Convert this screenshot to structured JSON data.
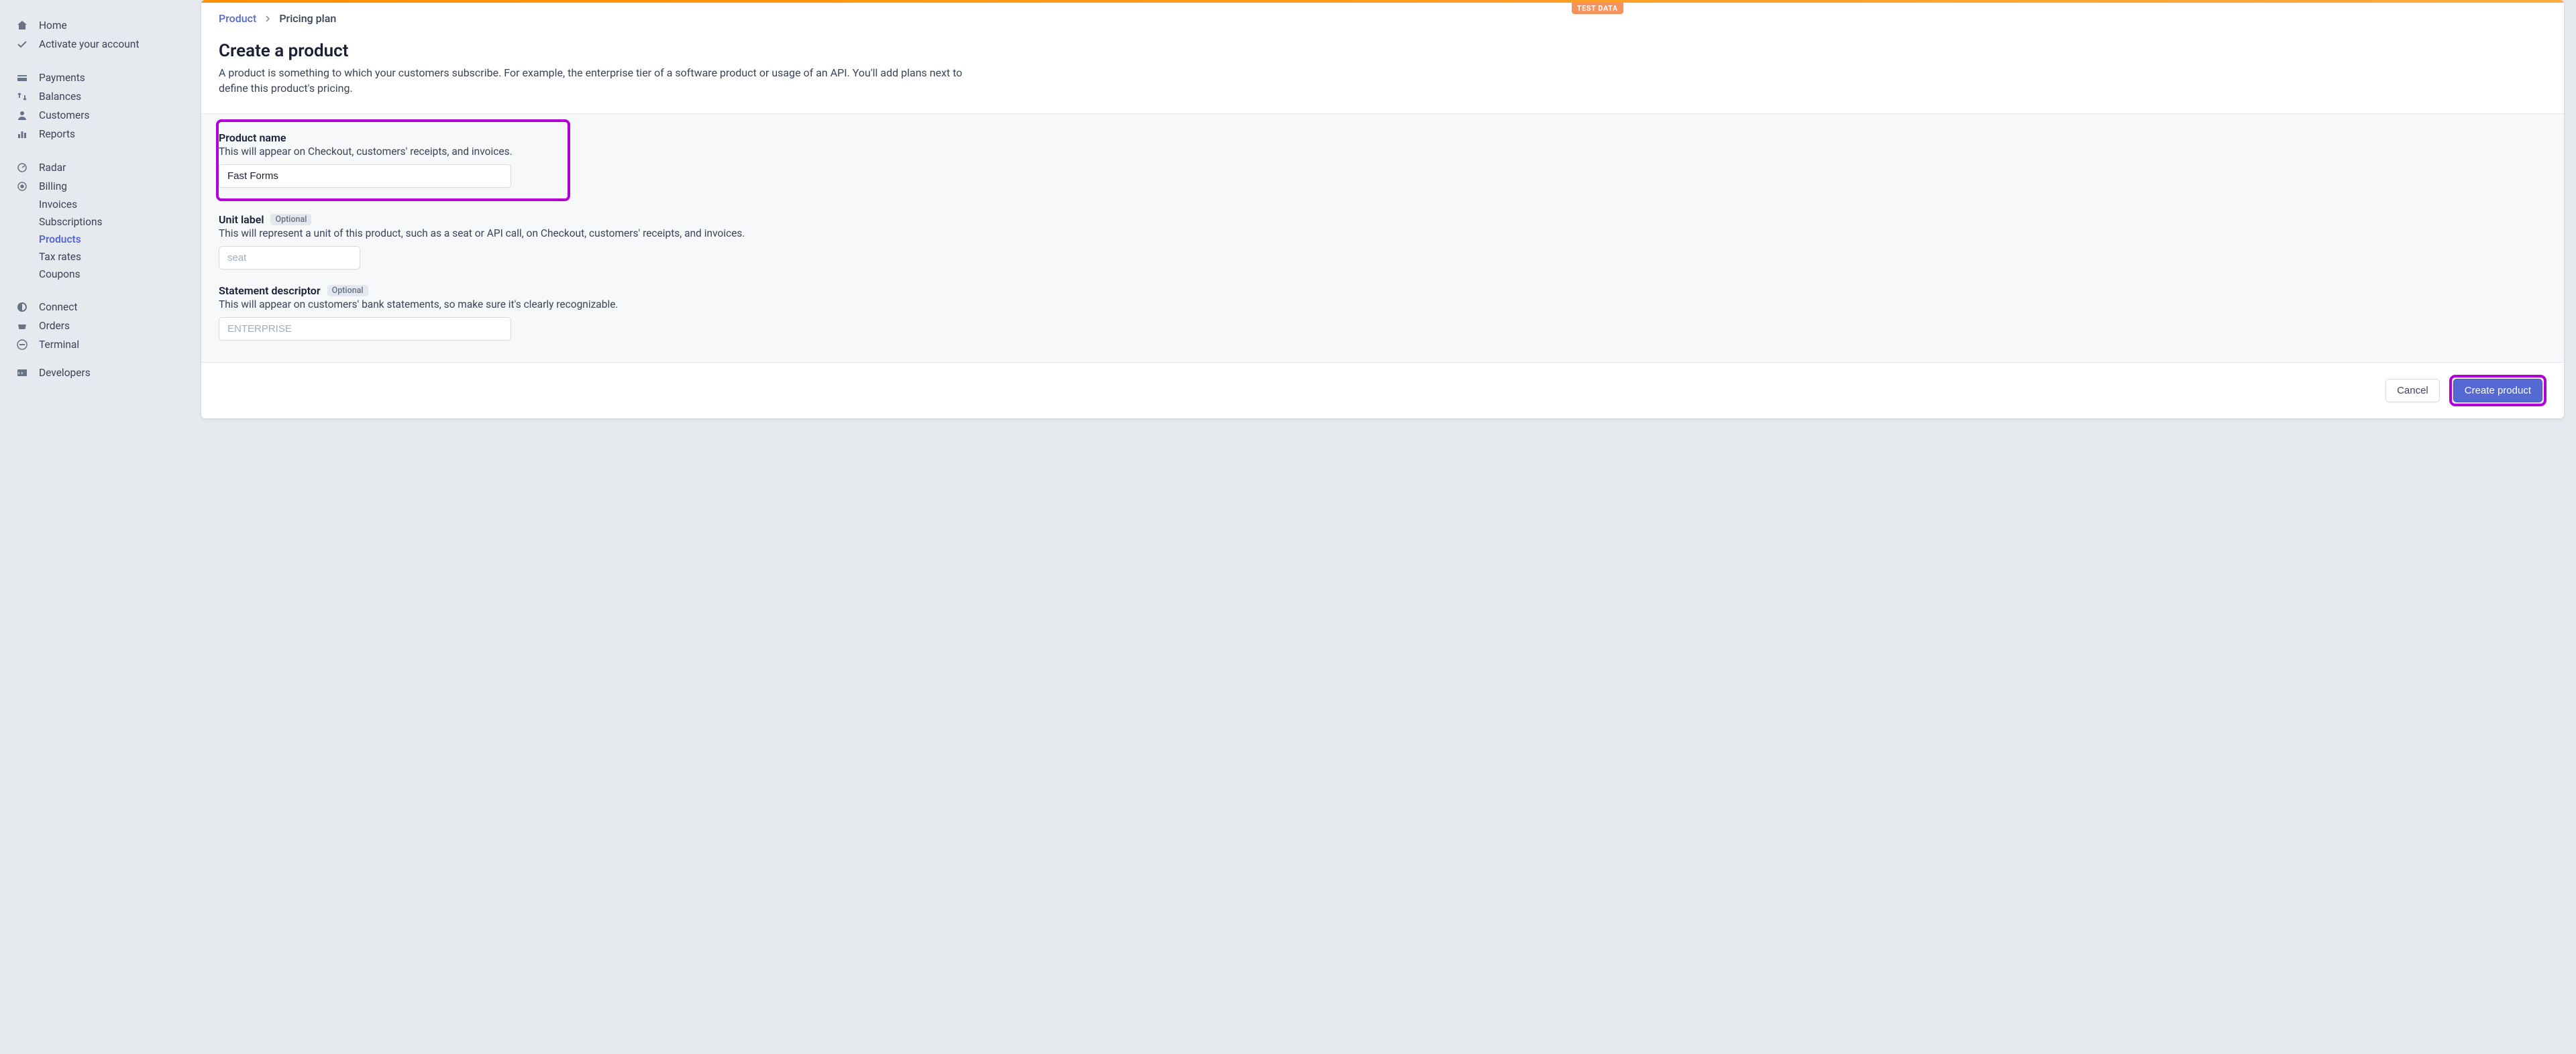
{
  "sidebar": {
    "primary": [
      {
        "icon": "home",
        "label": "Home"
      },
      {
        "icon": "check",
        "label": "Activate your account"
      }
    ],
    "business": [
      {
        "icon": "wallet",
        "label": "Payments"
      },
      {
        "icon": "transfer",
        "label": "Balances"
      },
      {
        "icon": "person",
        "label": "Customers"
      },
      {
        "icon": "chart",
        "label": "Reports"
      }
    ],
    "products": [
      {
        "icon": "radar",
        "label": "Radar"
      },
      {
        "icon": "billing",
        "label": "Billing"
      }
    ],
    "billing_sub": [
      {
        "label": "Invoices"
      },
      {
        "label": "Subscriptions"
      },
      {
        "label": "Products",
        "active": true
      },
      {
        "label": "Tax rates"
      },
      {
        "label": "Coupons"
      }
    ],
    "more": [
      {
        "icon": "connect",
        "label": "Connect"
      },
      {
        "icon": "orders",
        "label": "Orders"
      },
      {
        "icon": "terminal",
        "label": "Terminal"
      }
    ],
    "dev": [
      {
        "icon": "devs",
        "label": "Developers"
      }
    ]
  },
  "header": {
    "test_badge": "TEST DATA",
    "breadcrumb_root": "Product",
    "breadcrumb_current": "Pricing plan"
  },
  "page": {
    "title": "Create a product",
    "description": "A product is something to which your customers subscribe. For example, the enterprise tier of a software product or usage of an API. You'll add plans next to define this product's pricing."
  },
  "form": {
    "product_name": {
      "label": "Product name",
      "help": "This will appear on Checkout, customers' receipts, and invoices.",
      "value": "Fast Forms"
    },
    "unit_label": {
      "label": "Unit label",
      "optional": "Optional",
      "help": "This will represent a unit of this product, such as a seat or API call, on Checkout, customers' receipts, and invoices.",
      "placeholder": "seat"
    },
    "statement_descriptor": {
      "label": "Statement descriptor",
      "optional": "Optional",
      "help": "This will appear on customers' bank statements, so make sure it's clearly recognizable.",
      "placeholder": "ENTERPRISE"
    }
  },
  "footer": {
    "cancel": "Cancel",
    "submit": "Create product"
  }
}
